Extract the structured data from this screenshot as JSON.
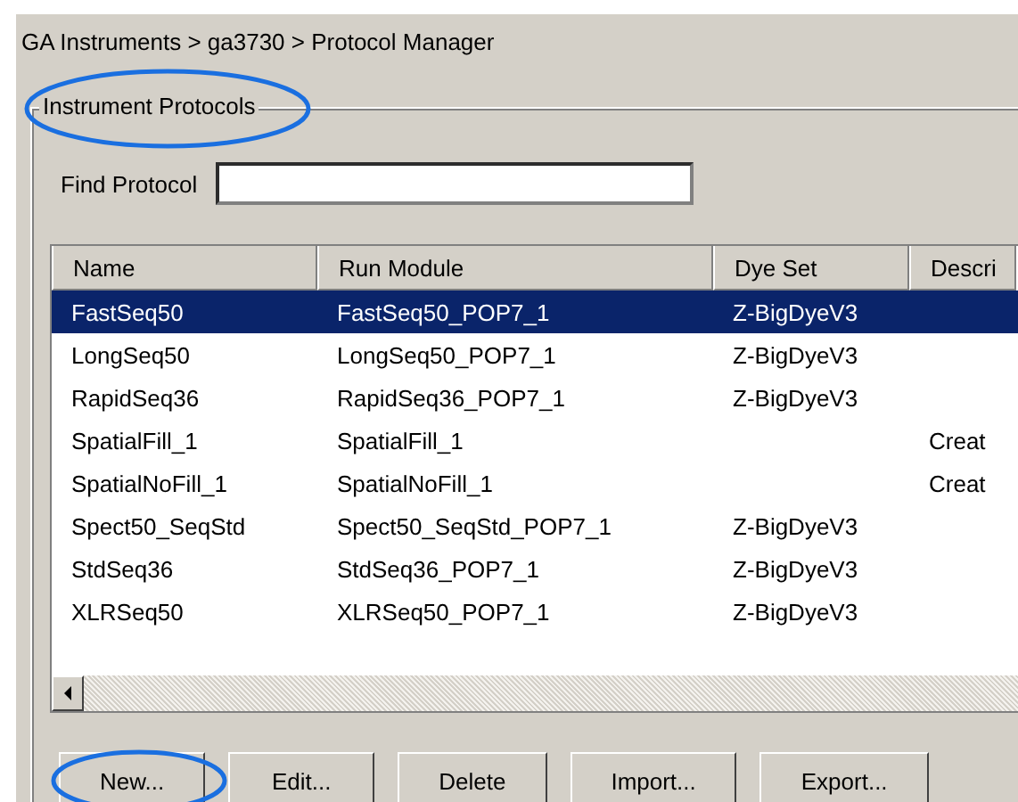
{
  "breadcrumb": "GA Instruments > ga3730 > Protocol Manager",
  "group_title": "Instrument Protocols",
  "find": {
    "label": "Find Protocol"
  },
  "table": {
    "columns": [
      "Name",
      "Run Module",
      "Dye Set",
      "Descri"
    ],
    "rows": [
      {
        "cells": [
          "FastSeq50",
          "FastSeq50_POP7_1",
          "Z-BigDyeV3",
          null
        ],
        "selected": true
      },
      {
        "cells": [
          "LongSeq50",
          "LongSeq50_POP7_1",
          "Z-BigDyeV3",
          null
        ],
        "selected": false
      },
      {
        "cells": [
          "RapidSeq36",
          "RapidSeq36_POP7_1",
          "Z-BigDyeV3",
          null
        ],
        "selected": false
      },
      {
        "cells": [
          "SpatialFill_1",
          "SpatialFill_1",
          null,
          "Creat"
        ],
        "selected": false
      },
      {
        "cells": [
          "SpatialNoFill_1",
          "SpatialNoFill_1",
          null,
          "Creat"
        ],
        "selected": false
      },
      {
        "cells": [
          "Spect50_SeqStd",
          "Spect50_SeqStd_POP7_1",
          "Z-BigDyeV3",
          null
        ],
        "selected": false
      },
      {
        "cells": [
          "StdSeq36",
          "StdSeq36_POP7_1",
          "Z-BigDyeV3",
          null
        ],
        "selected": false
      },
      {
        "cells": [
          "XLRSeq50",
          "XLRSeq50_POP7_1",
          "Z-BigDyeV3",
          null
        ],
        "selected": false
      }
    ]
  },
  "buttons": [
    "New...",
    "Edit...",
    "Delete",
    "Import...",
    "Export..."
  ]
}
